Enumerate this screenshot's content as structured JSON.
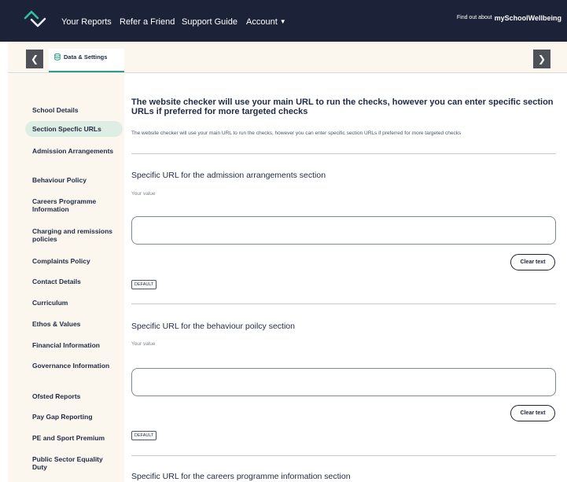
{
  "colors": {
    "nav_bg": "#1c2237",
    "panel_bg": "#fbf7ef",
    "accent": "#2e9e84",
    "active_item_bg": "#dfeee4"
  },
  "nav": {
    "logo_icon": "chevron-wave-logo-icon",
    "links": [
      "Your Reports",
      "Refer a Friend",
      "Support Guide",
      "Account"
    ],
    "account_icon": "chevron-down-icon",
    "promo_text": "Find out about",
    "promo_brand": "mySchoolWellbeing"
  },
  "tabbar": {
    "prev_icon": "chevron-left-icon",
    "next_icon": "chevron-right-icon",
    "active_tab_icon": "database-icon",
    "active_tab_label": "Data & Settings"
  },
  "sidebar": {
    "items": [
      "School Details",
      "Section Specfic URLs",
      "Admission Arrangements",
      "Behaviour Policy",
      "Careers Programme Information",
      "Charging and remissions policies",
      "Complaints Policy",
      "Contact Details",
      "Curriculum",
      "Ethos & Values",
      "Financial Information",
      "Governance Information",
      "Ofsted Reports",
      "Pay Gap Reporting",
      "PE and Sport Premium",
      "Public Sector Equality Duty"
    ],
    "active_index": 1
  },
  "main": {
    "heading": "The website checker will use your main URL to run the checks, however you can enter specific section URLs if preferred for more targeted checks",
    "subtext": "The website checker will use your main URL to run the checks, however you can enter specific section URLs if preferred for more targeted checks",
    "fields": [
      {
        "title": "Specific URL for the admission arrangements section",
        "hint": "Your value",
        "value": "",
        "clear_label": "Clear text",
        "default_label": "DEFAULT"
      },
      {
        "title": "Specific URL for the behaviour poilcy section",
        "hint": "Your value",
        "value": "",
        "clear_label": "Clear text",
        "default_label": "DEFAULT"
      },
      {
        "title": "Specific URL for the careers programme information section"
      }
    ]
  }
}
